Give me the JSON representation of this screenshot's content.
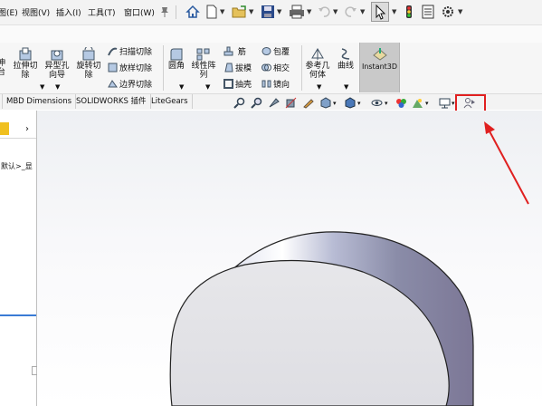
{
  "menu": {
    "items": [
      "图(E)",
      "视图(V)",
      "插入(I)",
      "工具(T)",
      "窗口(W)"
    ]
  },
  "ribbon": {
    "edge_label": "伸\n台",
    "extrude_cut": "拉伸切\n除",
    "hole_wizard": "异型孔\n向导",
    "revolve_cut": "旋转切\n除",
    "swept_cut": "扫描切除",
    "lofted_cut": "放样切除",
    "boundary_cut": "边界切除",
    "fillet": "圆角",
    "linear_pattern": "线性阵\n列",
    "rib": "筋",
    "draft": "拔模",
    "shell": "抽壳",
    "wrap": "包覆",
    "intersect": "相交",
    "mirror": "镜向",
    "ref_geometry": "参考几\n何体",
    "curves": "曲线",
    "instant3d": "Instant3D"
  },
  "tabs": [
    "MBD Dimensions",
    "SOLIDWORKS 插件",
    "LiteGears"
  ],
  "leftpanel": {
    "tree_text": "默认>_显"
  },
  "colors": {
    "highlight_box": "#e02020",
    "annotation_arrow": "#e02020",
    "instant3d_bg": "#c9c9c9"
  }
}
